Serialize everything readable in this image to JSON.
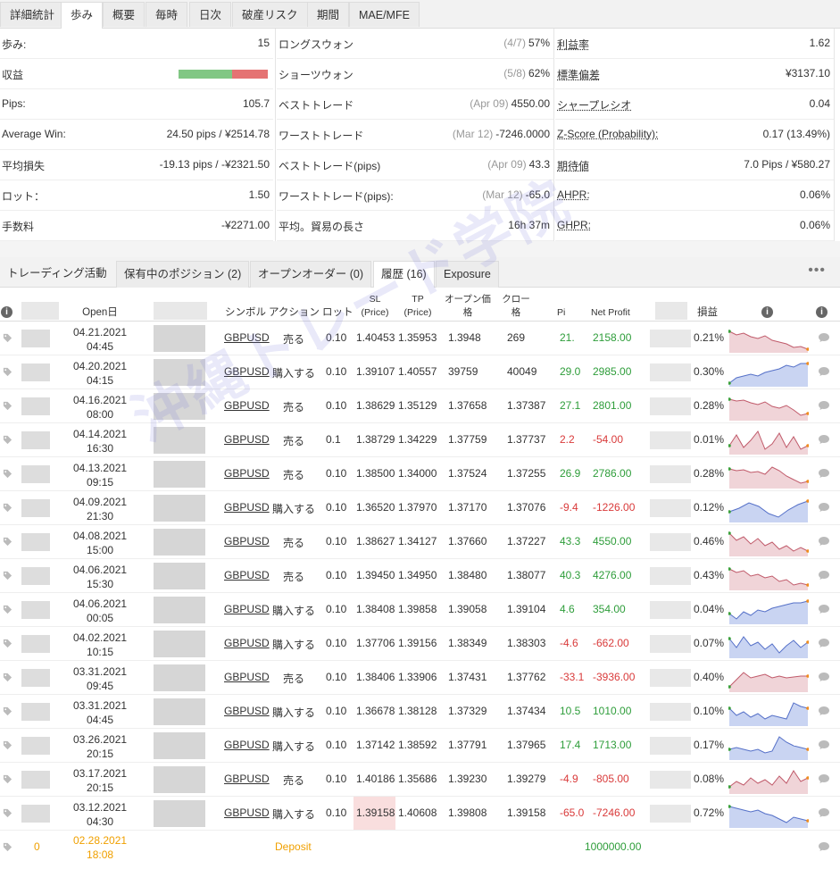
{
  "top_tabs": [
    "詳細統計",
    "歩み",
    "概要",
    "毎時",
    "日次",
    "破産リスク",
    "期間",
    "MAE/MFE"
  ],
  "stats": {
    "col1": [
      {
        "label": "歩み:",
        "value": "15"
      },
      {
        "label": "収益",
        "value": ""
      },
      {
        "label": "Pips:",
        "value": "105.7"
      },
      {
        "label": "Average Win:",
        "value": "24.50 pips / ¥2514.78"
      },
      {
        "label": "平均損失",
        "value": "-19.13 pips / -¥2321.50"
      },
      {
        "label": "ロット：",
        "value": "1.50"
      },
      {
        "label": "手数料",
        "value": "-¥2271.00"
      }
    ],
    "col2": [
      {
        "label": "ロングスウォン",
        "sub": "(4/7)",
        "value": "57%"
      },
      {
        "label": "ショーツウォン",
        "sub": "(5/8)",
        "value": "62%"
      },
      {
        "label": "ベストトレード",
        "sub": "(Apr 09)",
        "value": "4550.00"
      },
      {
        "label": "ワーストトレード",
        "sub": "(Mar 12)",
        "value": "-7246.0000"
      },
      {
        "label": "ベストトレード(pips)",
        "sub": "(Apr 09)",
        "value": "43.3"
      },
      {
        "label": "ワーストトレード(pips):",
        "sub": "(Mar 12)",
        "value": "-65.0"
      },
      {
        "label": "平均。貿易の長さ",
        "sub": "",
        "value": "16h 37m"
      }
    ],
    "col3": [
      {
        "label": "利益率",
        "value": "1.62"
      },
      {
        "label": "標準偏差",
        "value": "¥3137.10"
      },
      {
        "label": "シャープレシオ",
        "value": "0.04"
      },
      {
        "label": "Z-Score (Probability):",
        "value": "0.17 (13.49%)"
      },
      {
        "label": "期待値",
        "value": "7.0 Pips / ¥580.27"
      },
      {
        "label": "AHPR:",
        "value": "0.06%"
      },
      {
        "label": "GHPR:",
        "value": "0.06%"
      }
    ],
    "profit_win_fraction": 0.6
  },
  "activity_tabs": [
    "トレーディング活動",
    "保有中のポジション (2)",
    "オープンオーダー (0)",
    "履歴 (16)",
    "Exposure"
  ],
  "more_label": "•••",
  "headers": {
    "open_date": "Open日",
    "symbol": "シンボル",
    "action": "アクション",
    "lots": "ロット",
    "sl": "SL",
    "sl_sub": "(Price)",
    "tp": "TP",
    "tp_sub": "(Price)",
    "open_price_1": "オープン価",
    "open_price_2": "格",
    "close_price_1": "クロー",
    "close_price_2": "格",
    "pips": "Pi",
    "net_profit": "Net Profit",
    "gain": "損益",
    "info": "i"
  },
  "trades": [
    {
      "date": "04.21.2021",
      "time": "04:45",
      "symbol": "GBPUSD",
      "action": "売る",
      "lots": "0.10",
      "sl": "1.40453",
      "tp": "1.35953",
      "open": "1.3948",
      "close": "269",
      "pips": "21.",
      "profit": "2158.00",
      "gain": "0.21%",
      "dir": "pos",
      "spark": [
        8,
        12,
        10,
        14,
        16,
        13,
        18,
        20,
        22,
        26,
        25,
        28
      ]
    },
    {
      "date": "04.20.2021",
      "time": "04:15",
      "symbol": "GBPUSD",
      "action": "購入する",
      "lots": "0.10",
      "sl": "1.39107",
      "tp": "1.40557",
      "open": "39759",
      "close": "40049",
      "pips": "29.0",
      "profit": "2985.00",
      "gain": "0.30%",
      "dir": "pos",
      "spark": [
        28,
        22,
        20,
        18,
        20,
        16,
        14,
        12,
        8,
        10,
        6,
        6
      ]
    },
    {
      "date": "04.16.2021",
      "time": "08:00",
      "symbol": "GBPUSD",
      "action": "売る",
      "lots": "0.10",
      "sl": "1.38629",
      "tp": "1.35129",
      "open": "1.37658",
      "close": "1.37387",
      "pips": "27.1",
      "profit": "2801.00",
      "gain": "0.28%",
      "dir": "pos",
      "spark": [
        8,
        10,
        9,
        12,
        14,
        11,
        16,
        18,
        15,
        20,
        26,
        24
      ]
    },
    {
      "date": "04.14.2021",
      "time": "16:30",
      "symbol": "GBPUSD",
      "action": "売る",
      "lots": "0.1",
      "sl": "1.38729",
      "tp": "1.34229",
      "open": "1.37759",
      "close": "1.37737",
      "pips": "2.2",
      "profit": "-54.00",
      "gain": "0.01%",
      "dir": "neg",
      "spark": [
        22,
        10,
        24,
        16,
        6,
        26,
        20,
        8,
        24,
        12,
        26,
        22
      ]
    },
    {
      "date": "04.13.2021",
      "time": "09:15",
      "symbol": "GBPUSD",
      "action": "売る",
      "lots": "0.10",
      "sl": "1.38500",
      "tp": "1.34000",
      "open": "1.37524",
      "close": "1.37255",
      "pips": "26.9",
      "profit": "2786.00",
      "gain": "0.28%",
      "dir": "pos",
      "spark": [
        10,
        12,
        11,
        14,
        13,
        16,
        8,
        12,
        18,
        22,
        26,
        24
      ]
    },
    {
      "date": "04.09.2021",
      "time": "21:30",
      "symbol": "GBPUSD",
      "action": "購入する",
      "lots": "0.10",
      "sl": "1.36520",
      "tp": "1.37970",
      "open": "1.37170",
      "close": "1.37076",
      "pips": "-9.4",
      "profit": "-1226.00",
      "gain": "0.12%",
      "dir": "neg",
      "spark": [
        20,
        16,
        10,
        14,
        22,
        26,
        18,
        12,
        8
      ]
    },
    {
      "date": "04.08.2021",
      "time": "15:00",
      "symbol": "GBPUSD",
      "action": "売る",
      "lots": "0.10",
      "sl": "1.38627",
      "tp": "1.34127",
      "open": "1.37660",
      "close": "1.37227",
      "pips": "43.3",
      "profit": "4550.00",
      "gain": "0.46%",
      "dir": "pos",
      "spark": [
        6,
        14,
        10,
        18,
        12,
        20,
        16,
        24,
        20,
        26,
        22,
        26
      ]
    },
    {
      "date": "04.06.2021",
      "time": "15:30",
      "symbol": "GBPUSD",
      "action": "売る",
      "lots": "0.10",
      "sl": "1.39450",
      "tp": "1.34950",
      "open": "1.38480",
      "close": "1.38077",
      "pips": "40.3",
      "profit": "4276.00",
      "gain": "0.43%",
      "dir": "pos",
      "spark": [
        8,
        12,
        10,
        16,
        14,
        18,
        16,
        22,
        20,
        26,
        24,
        26
      ]
    },
    {
      "date": "04.06.2021",
      "time": "00:05",
      "symbol": "GBPUSD",
      "action": "購入する",
      "lots": "0.10",
      "sl": "1.38408",
      "tp": "1.39858",
      "open": "1.39058",
      "close": "1.39104",
      "pips": "4.6",
      "profit": "354.00",
      "gain": "0.04%",
      "dir": "pos",
      "spark": [
        20,
        26,
        18,
        22,
        16,
        18,
        14,
        12,
        10,
        8,
        8,
        6
      ]
    },
    {
      "date": "04.02.2021",
      "time": "10:15",
      "symbol": "GBPUSD",
      "action": "購入する",
      "lots": "0.10",
      "sl": "1.37706",
      "tp": "1.39156",
      "open": "1.38349",
      "close": "1.38303",
      "pips": "-4.6",
      "profit": "-662.00",
      "gain": "0.07%",
      "dir": "neg",
      "spark": [
        10,
        20,
        8,
        18,
        14,
        22,
        16,
        26,
        18,
        12,
        20,
        14
      ]
    },
    {
      "date": "03.31.2021",
      "time": "09:45",
      "symbol": "GBPUSD",
      "action": "売る",
      "lots": "0.10",
      "sl": "1.38406",
      "tp": "1.33906",
      "open": "1.37431",
      "close": "1.37762",
      "pips": "-33.1",
      "profit": "-3936.00",
      "gain": "0.40%",
      "dir": "neg",
      "spark": [
        26,
        18,
        10,
        16,
        14,
        12,
        16,
        14,
        16,
        15,
        14,
        14
      ]
    },
    {
      "date": "03.31.2021",
      "time": "04:45",
      "symbol": "GBPUSD",
      "action": "購入する",
      "lots": "0.10",
      "sl": "1.36678",
      "tp": "1.38128",
      "open": "1.37329",
      "close": "1.37434",
      "pips": "10.5",
      "profit": "1010.00",
      "gain": "0.10%",
      "dir": "pos",
      "spark": [
        12,
        20,
        16,
        22,
        18,
        24,
        20,
        22,
        24,
        6,
        10,
        12
      ]
    },
    {
      "date": "03.26.2021",
      "time": "20:15",
      "symbol": "GBPUSD",
      "action": "購入する",
      "lots": "0.10",
      "sl": "1.37142",
      "tp": "1.38592",
      "open": "1.37791",
      "close": "1.37965",
      "pips": "17.4",
      "profit": "1713.00",
      "gain": "0.17%",
      "dir": "pos",
      "spark": [
        20,
        18,
        20,
        22,
        20,
        24,
        22,
        6,
        12,
        16,
        18,
        20
      ]
    },
    {
      "date": "03.17.2021",
      "time": "20:15",
      "symbol": "GBPUSD",
      "action": "売る",
      "lots": "0.10",
      "sl": "1.40186",
      "tp": "1.35686",
      "open": "1.39230",
      "close": "1.39279",
      "pips": "-4.9",
      "profit": "-805.00",
      "gain": "0.08%",
      "dir": "neg",
      "spark": [
        24,
        18,
        22,
        14,
        20,
        16,
        22,
        12,
        20,
        6,
        18,
        14
      ]
    },
    {
      "date": "03.12.2021",
      "time": "04:30",
      "symbol": "GBPUSD",
      "action": "購入する",
      "lots": "0.10",
      "sl": "1.39158",
      "tp": "1.40608",
      "open": "1.39808",
      "close": "1.39158",
      "pips": "-65.0",
      "profit": "-7246.00",
      "gain": "0.72%",
      "dir": "neg",
      "spark": [
        8,
        10,
        12,
        14,
        12,
        16,
        18,
        22,
        26,
        20,
        22,
        24
      ]
    }
  ],
  "deposit": {
    "count": "0",
    "date": "02.28.2021",
    "time": "18:08",
    "type": "Deposit",
    "amount": "1000000.00"
  },
  "watermark": "沖縄トレード学院"
}
